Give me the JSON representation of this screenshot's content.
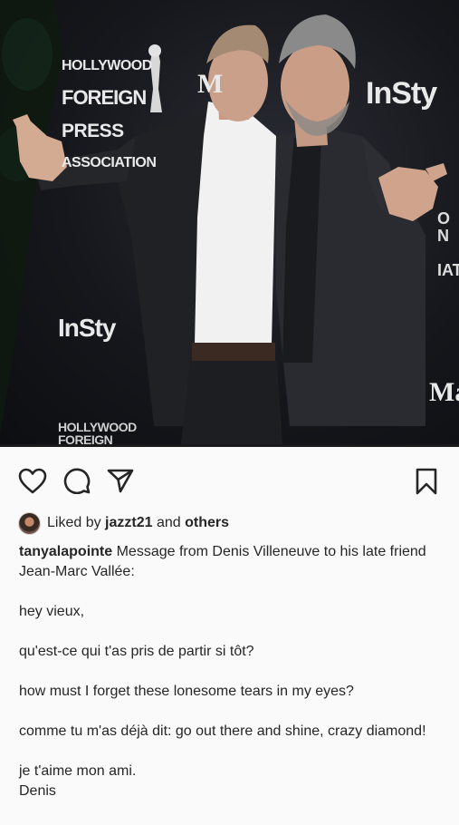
{
  "photo": {
    "logos": {
      "hfpa_lines": [
        "HOLLYWOOD",
        "FOREIGN",
        "PRESS",
        "ASSOCIATION"
      ],
      "instyle_top": "InSty",
      "instyle_left": "InSty",
      "hfpa_bottom": "HOLLYWOOD\nFOREIGN",
      "m_logo": "M",
      "ma_logo": "Ma",
      "right_partial": "O\nN\n\nIATIO"
    }
  },
  "actions": {
    "icons": [
      "heart-icon",
      "comment-icon",
      "share-icon",
      "bookmark-icon"
    ]
  },
  "likes": {
    "prefix": "Liked by",
    "user": "jazzt21",
    "connector": "and",
    "others": "others"
  },
  "post": {
    "username": "tanyalapointe",
    "caption_first": "Message from Denis Villeneuve to his late friend Jean-Marc Vallée:",
    "lines": [
      "hey vieux,",
      "qu'est-ce qui t'as pris de partir si tôt?",
      "how must I forget these lonesome tears in my eyes?",
      "comme tu m'as déjà dit: go out there and shine, crazy diamond!"
    ],
    "closing": "je t'aime mon ami.",
    "signature": "Denis"
  },
  "colors": {
    "background": "#fafafa",
    "text": "#262626",
    "photo_bg": "#16171c"
  }
}
